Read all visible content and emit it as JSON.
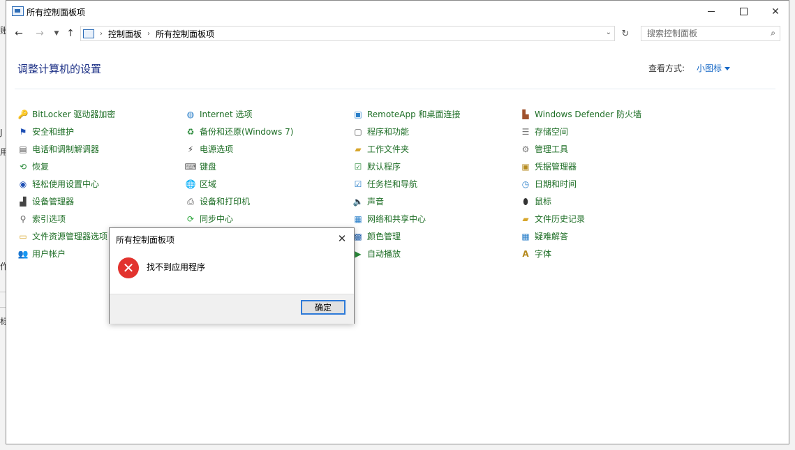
{
  "window": {
    "title": "所有控制面板项",
    "controls": {
      "minimize": "minimize-icon",
      "maximize": "maximize-icon",
      "close": "close-icon"
    }
  },
  "navigation": {
    "back": "back-arrow-icon",
    "forward": "forward-arrow-icon",
    "recent": "chevron-down-icon",
    "up": "up-arrow-icon",
    "breadcrumbs": [
      "控制面板",
      "所有控制面板项"
    ],
    "search_placeholder": "搜索控制面板"
  },
  "header": {
    "title": "调整计算机的设置",
    "view_label": "查看方式:",
    "view_value": "小图标"
  },
  "items": {
    "col0": [
      {
        "label": "BitLocker 驱动器加密",
        "icon": "bitlocker-icon"
      },
      {
        "label": "安全和维护",
        "icon": "flag-icon"
      },
      {
        "label": "电话和调制解调器",
        "icon": "modem-icon"
      },
      {
        "label": "恢复",
        "icon": "recovery-icon"
      },
      {
        "label": "轻松使用设置中心",
        "icon": "accessibility-icon"
      },
      {
        "label": "设备管理器",
        "icon": "device-manager-icon"
      },
      {
        "label": "索引选项",
        "icon": "indexing-icon"
      },
      {
        "label": "文件资源管理器选项",
        "icon": "folder-options-icon"
      },
      {
        "label": "用户帐户",
        "icon": "user-accounts-icon"
      }
    ],
    "col1": [
      {
        "label": "Internet 选项",
        "icon": "internet-options-icon"
      },
      {
        "label": "备份和还原(Windows 7)",
        "icon": "backup-icon"
      },
      {
        "label": "电源选项",
        "icon": "power-icon"
      },
      {
        "label": "键盘",
        "icon": "keyboard-icon"
      },
      {
        "label": "区域",
        "icon": "region-icon"
      },
      {
        "label": "设备和打印机",
        "icon": "printer-icon"
      },
      {
        "label": "同步中心",
        "icon": "sync-icon"
      }
    ],
    "col2": [
      {
        "label": "RemoteApp 和桌面连接",
        "icon": "remoteapp-icon"
      },
      {
        "label": "程序和功能",
        "icon": "programs-icon"
      },
      {
        "label": "工作文件夹",
        "icon": "work-folders-icon"
      },
      {
        "label": "默认程序",
        "icon": "default-programs-icon"
      },
      {
        "label": "任务栏和导航",
        "icon": "taskbar-icon"
      },
      {
        "label": "声音",
        "icon": "speaker-icon"
      },
      {
        "label": "网络和共享中心",
        "icon": "network-icon"
      },
      {
        "label": "颜色管理",
        "icon": "color-management-icon"
      },
      {
        "label": "自动播放",
        "icon": "autoplay-icon"
      }
    ],
    "col3": [
      {
        "label": "Windows Defender 防火墙",
        "icon": "firewall-icon"
      },
      {
        "label": "存储空间",
        "icon": "storage-spaces-icon"
      },
      {
        "label": "管理工具",
        "icon": "admin-tools-icon"
      },
      {
        "label": "凭据管理器",
        "icon": "credential-manager-icon"
      },
      {
        "label": "日期和时间",
        "icon": "date-time-icon"
      },
      {
        "label": "鼠标",
        "icon": "mouse-icon"
      },
      {
        "label": "文件历史记录",
        "icon": "file-history-icon"
      },
      {
        "label": "疑难解答",
        "icon": "troubleshooting-icon"
      },
      {
        "label": "字体",
        "icon": "fonts-icon"
      }
    ]
  },
  "dialog": {
    "title": "所有控制面板项",
    "message": "找不到应用程序",
    "ok_label": "确定",
    "icon": "error-icon"
  },
  "background_fragments": [
    "账",
    "J",
    "用",
    "作",
    "标"
  ],
  "colors": {
    "link_green": "#1e6e26",
    "heading_blue": "#1e3287",
    "accent_blue": "#1668c6",
    "error_red": "#e2332e"
  }
}
